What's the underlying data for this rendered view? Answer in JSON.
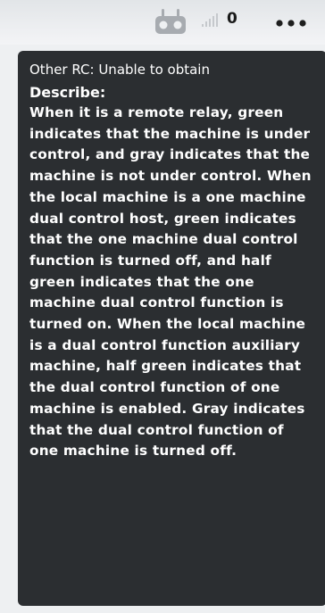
{
  "status_bar": {
    "rc_icon": "remote-controller-icon",
    "signal_icon": "signal-strength-icon",
    "signal_count": "0",
    "more_icon": "more-dots-icon"
  },
  "tooltip": {
    "other_rc_text": "Other RC: Unable to obtain",
    "describe_title": "Describe:",
    "describe_body": "When it is a remote relay, green indicates that the machine is under control, and gray indicates that the machine is not under control. When the local machine is a one machine dual control host, green indicates that the one machine dual control function is turned off, and half green indicates that the one machine dual control function is turned on. When the local machine is a dual control function auxiliary machine, half green indicates that the dual control function of one machine is enabled. Gray indicates that the dual control function of one machine is turned off."
  },
  "colors": {
    "tooltip_background": "#2b2e31",
    "tooltip_text": "#ffffff",
    "icon_gray": "#a7abb0"
  }
}
